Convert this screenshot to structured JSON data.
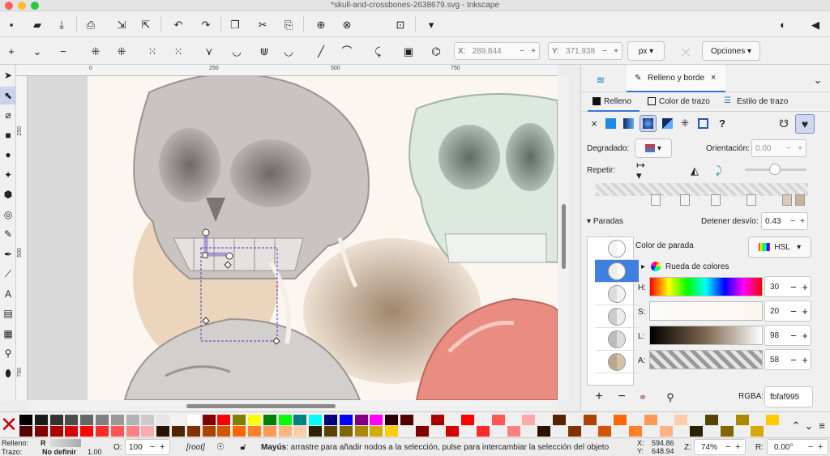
{
  "window": {
    "title": "*skull-and-crossbones-2638679.svg - Inkscape"
  },
  "commands": [
    {
      "name": "new-document-icon",
      "glyph": "▪"
    },
    {
      "name": "open-document-icon",
      "glyph": "▰"
    },
    {
      "name": "save-icon",
      "glyph": "⤓"
    },
    {
      "name": "print-icon",
      "glyph": "⎙"
    },
    {
      "name": "import-icon",
      "glyph": "⇲"
    },
    {
      "name": "export-icon",
      "glyph": "⇱"
    },
    {
      "name": "undo-icon",
      "glyph": "↶"
    },
    {
      "name": "redo-icon",
      "glyph": "↷"
    },
    {
      "name": "copy-icon",
      "glyph": "❐"
    },
    {
      "name": "cut-icon",
      "glyph": "✂"
    },
    {
      "name": "paste-icon",
      "glyph": "⎘"
    },
    {
      "name": "zoom-selection-icon",
      "glyph": "⊕"
    },
    {
      "name": "zoom-drawing-icon",
      "glyph": "⊗"
    },
    {
      "name": "zoom-page-icon",
      "glyph": "⊡"
    },
    {
      "name": "commands-overflow-icon",
      "glyph": "▾"
    },
    {
      "name": "snap-toggle-icon",
      "glyph": "◐"
    },
    {
      "name": "collapse-panel-icon",
      "glyph": "◀"
    }
  ],
  "node_tools": [
    {
      "name": "insert-node-icon",
      "glyph": "+"
    },
    {
      "name": "node-menu-icon",
      "glyph": "⌄"
    },
    {
      "name": "delete-node-icon",
      "glyph": "−"
    },
    {
      "name": "join-nodes-icon",
      "glyph": "⁜"
    },
    {
      "name": "break-node-icon",
      "glyph": "⁜"
    },
    {
      "name": "join-segment-icon",
      "glyph": "⁙"
    },
    {
      "name": "delete-segment-icon",
      "glyph": "⁙"
    },
    {
      "name": "cusp-node-icon",
      "glyph": "⋎"
    },
    {
      "name": "smooth-node-icon",
      "glyph": "◡"
    },
    {
      "name": "symmetric-node-icon",
      "glyph": "⋓"
    },
    {
      "name": "auto-smooth-node-icon",
      "glyph": "◡"
    },
    {
      "name": "segment-line-icon",
      "glyph": "╱"
    },
    {
      "name": "segment-curve-icon",
      "glyph": "⌒"
    },
    {
      "name": "object-to-path-icon",
      "glyph": "⤹"
    },
    {
      "name": "stroke-to-path-icon",
      "glyph": "▣"
    },
    {
      "name": "clip-path-icon",
      "glyph": "⌬"
    }
  ],
  "coords": {
    "x_label": "X:",
    "x_value": "289.844",
    "y_label": "Y:",
    "y_value": "371.938",
    "unit": "px",
    "options_label": "Opciones"
  },
  "tools": [
    {
      "name": "selector-tool-icon",
      "glyph": "➤"
    },
    {
      "name": "node-tool-icon",
      "glyph": "⬉"
    },
    {
      "name": "tweak-tool-icon",
      "glyph": "⌀"
    },
    {
      "name": "rect-tool-icon",
      "glyph": "■"
    },
    {
      "name": "ellipse-tool-icon",
      "glyph": "●"
    },
    {
      "name": "star-tool-icon",
      "glyph": "✦"
    },
    {
      "name": "3dbox-tool-icon",
      "glyph": "⬢"
    },
    {
      "name": "spiral-tool-icon",
      "glyph": "◎"
    },
    {
      "name": "pencil-tool-icon",
      "glyph": "✎"
    },
    {
      "name": "pen-tool-icon",
      "glyph": "✒"
    },
    {
      "name": "calligraphy-tool-icon",
      "glyph": "⟋"
    },
    {
      "name": "text-tool-icon",
      "glyph": "A"
    },
    {
      "name": "gradient-tool-icon",
      "glyph": "▤"
    },
    {
      "name": "mesh-tool-icon",
      "glyph": "▦"
    },
    {
      "name": "dropper-tool-icon",
      "glyph": "⚲"
    },
    {
      "name": "paint-bucket-tool-icon",
      "glyph": "⬮"
    }
  ],
  "ruler": {
    "h_ticks": [
      "0",
      "250",
      "500",
      "750"
    ],
    "v_ticks": [
      "250",
      "500",
      "750"
    ]
  },
  "panel": {
    "tab_label": "Relleno y borde",
    "subtabs": [
      "Relleno",
      "Color de trazo",
      "Estilo de trazo"
    ],
    "gradient_label": "Degradado:",
    "orientation_label": "Orientación:",
    "orientation_value": "0.00",
    "repeat_label": "Repetir:",
    "stops_label": "Paradas",
    "offset_label": "Detener desvío:",
    "offset_value": "0.43",
    "stop_color_label": "Color de parada",
    "model_value": "HSL",
    "wheel_label": "Rueda de colores",
    "channels": [
      {
        "label": "H:",
        "value": "30"
      },
      {
        "label": "S:",
        "value": "20"
      },
      {
        "label": "L:",
        "value": "98"
      },
      {
        "label": "A:",
        "value": "58"
      }
    ],
    "rgba_label": "RGBA:",
    "rgba_value": "fbfaf995",
    "add_stop": "+",
    "remove_stop": "−"
  },
  "status": {
    "fill_label": "Relleno:",
    "fill_value": "R",
    "stroke_label": "Trazo:",
    "stroke_value": "No definir",
    "stroke_width": "1.00",
    "opacity_label": "O:",
    "opacity_value": "100",
    "layer": "[root]",
    "message_bold": "Mayús",
    "message": ": arrastre para añadir nodos a la selección, pulse para intercambiar la selección del objeto",
    "cursor_x_label": "X:",
    "cursor_x": "594.86",
    "cursor_y_label": "Y:",
    "cursor_y": "648.94",
    "zoom_label": "Z:",
    "zoom_value": "74%",
    "rotate_label": "R:",
    "rotate_value": "0.00°"
  },
  "palette": {
    "colors": [
      "#000000",
      "#1a1a1a",
      "#333333",
      "#4d4d4d",
      "#666666",
      "#808080",
      "#999999",
      "#b3b3b3",
      "#cccccc",
      "#e6e6e6",
      "#f2f2f2",
      "#ffffff",
      "#800000",
      "#ff0000",
      "#808000",
      "#ffff00",
      "#008000",
      "#00ff00",
      "#008080",
      "#00ffff",
      "#000080",
      "#0000ff",
      "#800080",
      "#ff00ff",
      "#2b0000",
      "#550000",
      "#800000",
      "#aa0000",
      "#d40000",
      "#ff0000",
      "#ff2a2a",
      "#ff5555",
      "#ff8080",
      "#ffaaaa",
      "#2b1100",
      "#552200",
      "#803300",
      "#aa4400",
      "#d45500",
      "#ff6600",
      "#ff7f2a",
      "#ff9955",
      "#ffb380",
      "#ffccaa",
      "#2b2200",
      "#554400",
      "#806600",
      "#aa8800",
      "#d4aa00",
      "#ffcc00"
    ]
  }
}
